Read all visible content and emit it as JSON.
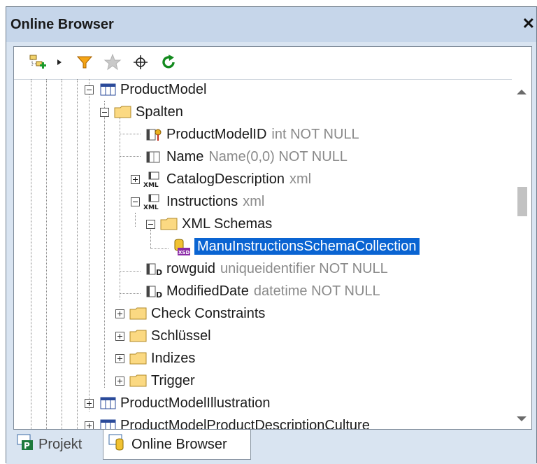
{
  "panel": {
    "title": "Online Browser",
    "close_glyph": "✕"
  },
  "toolbar": {
    "icons": [
      "add-objects-icon",
      "dropdown-arrow-icon",
      "filter-icon",
      "favorites-star-icon",
      "locate-icon",
      "refresh-icon"
    ]
  },
  "tree": {
    "product_model": "ProductModel",
    "spalten": "Spalten",
    "columns": [
      {
        "name": "ProductModelID",
        "type": "int NOT NULL"
      },
      {
        "name": "Name",
        "type": "Name(0,0) NOT NULL"
      },
      {
        "name": "CatalogDescription",
        "type": "xml"
      },
      {
        "name": "Instructions",
        "type": "xml"
      },
      {
        "name": "rowguid",
        "type": "uniqueidentifier NOT NULL"
      },
      {
        "name": "ModifiedDate",
        "type": "datetime NOT NULL"
      }
    ],
    "xml_schemas": "XML Schemas",
    "schema_collection": "ManuInstructionsSchemaCollection",
    "folders": [
      "Check Constraints",
      "Schlüssel",
      "Indizes",
      "Trigger"
    ],
    "next_table": "ProductModelIllustration",
    "partial_table": "ProductModelProductDescriptionCulture"
  },
  "tabs": [
    {
      "label": "Projekt",
      "active": false
    },
    {
      "label": "Online Browser",
      "active": true
    }
  ],
  "colors": {
    "selection": "#0a64d2",
    "title_bg": "#c6d6ea",
    "type_text": "#8a8a8a"
  }
}
